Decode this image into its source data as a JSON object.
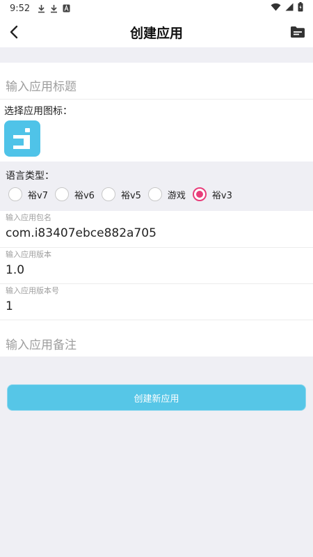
{
  "status_bar": {
    "time": "9:52",
    "icons": [
      "download-icon",
      "download-icon",
      "font-icon"
    ],
    "right_icons": [
      "wifi-icon",
      "signal-icon",
      "battery-icon"
    ]
  },
  "app_bar": {
    "title": "创建应用",
    "back_icon": "back-arrow-icon",
    "action_icon": "folder-icon"
  },
  "form": {
    "title_placeholder": "输入应用标题",
    "icon_label": "选择应用图标：",
    "language_label": "语言类型：",
    "languages": [
      "裕v7",
      "裕v6",
      "裕v5",
      "游戏",
      "裕v3"
    ],
    "selected_language": "裕v3",
    "package_label": "输入应用包名",
    "package_value": "com.i83407ebce882a705",
    "version_label": "输入应用版本",
    "version_value": "1.0",
    "version_code_label": "输入应用版本号",
    "version_code_value": "1",
    "remark_placeholder": "输入应用备注"
  },
  "buttons": {
    "create_label": "创建新应用"
  },
  "colors": {
    "accent": "#56c6e7",
    "radio_selected": "#e83d7a",
    "background": "#efeff4"
  }
}
